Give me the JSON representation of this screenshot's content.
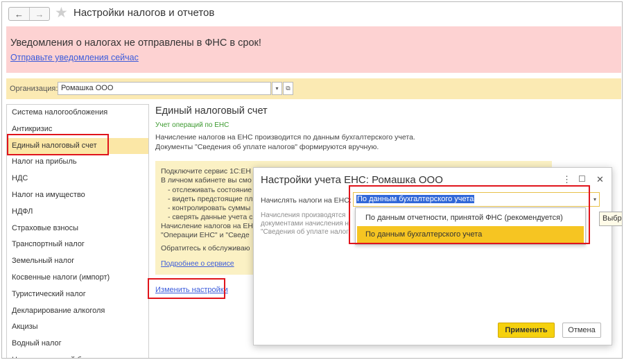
{
  "window": {
    "title": "Настройки налогов и отчетов",
    "back_icon": "←",
    "forward_icon": "→",
    "star_icon": "★"
  },
  "alert": {
    "title": "Уведомления о налогах не отправлены в ФНС в срок!",
    "link": "Отправьте уведомления сейчас"
  },
  "organization": {
    "label": "Организация:",
    "value": "Ромашка ООО"
  },
  "sidebar": {
    "items": [
      {
        "label": "Система налогообложения"
      },
      {
        "label": "Антикризис"
      },
      {
        "label": "Единый налоговый счет"
      },
      {
        "label": "Налог на прибыль"
      },
      {
        "label": "НДС"
      },
      {
        "label": "Налог на имущество"
      },
      {
        "label": "НДФЛ"
      },
      {
        "label": "Страховые взносы"
      },
      {
        "label": "Транспортный налог"
      },
      {
        "label": "Земельный налог"
      },
      {
        "label": "Косвенные налоги (импорт)"
      },
      {
        "label": "Туристический налог"
      },
      {
        "label": "Декларирование алкоголя"
      },
      {
        "label": "Акцизы"
      },
      {
        "label": "Водный налог"
      },
      {
        "label": "Налог на игорный бизнес"
      }
    ]
  },
  "main": {
    "title": "Единый налоговый счет",
    "subtitle": "Учет операций по ЕНС",
    "line1": "Начисление налогов на ЕНС производится по данным бухгалтерского учета.",
    "line2": "Документы \"Сведения об уплате налогов\" формируются вручную.",
    "info": {
      "l1": "Подключите сервис 1С:ЕН",
      "l2": "В личном кабинете вы смо",
      "l3": "- отслеживать состояние",
      "l4": "- видеть предстоящие пл",
      "l5": "- контролировать суммы",
      "l6": "- сверять данные учета с",
      "l7": "Начисление налогов на ЕН",
      "l8": "\"Операции ЕНС\" и \"Сведе",
      "l9": "Обратитесь к обслуживаю",
      "link": "Подробнее о сервисе"
    },
    "change_link": "Изменить настройки"
  },
  "dialog": {
    "title": "Настройки учета ЕНС: Ромашка ООО",
    "field_label": "Начислять налоги на ЕНС:",
    "field_value": "По данным бухгалтерского учета",
    "hint1": "Начисления производятся",
    "hint2": "документами начисления н",
    "hint3": "\"Сведения об уплате налог",
    "options": [
      {
        "label": "По данным отчетности, принятой ФНС (рекомендуется)",
        "selected": false
      },
      {
        "label": "По данным бухгалтерского учета",
        "selected": true
      }
    ],
    "tooltip": "Выбрать",
    "apply": "Применить",
    "cancel": "Отмена"
  },
  "colors": {
    "alert_bg": "#fdd2d2",
    "org_bar_bg": "#fbeab3",
    "active_item_bg": "#fbe7a6",
    "highlight_border": "#e0141b",
    "link": "#3b5bdb",
    "apply_bg": "#f5d10e",
    "selected_option_bg": "#f6c522"
  }
}
